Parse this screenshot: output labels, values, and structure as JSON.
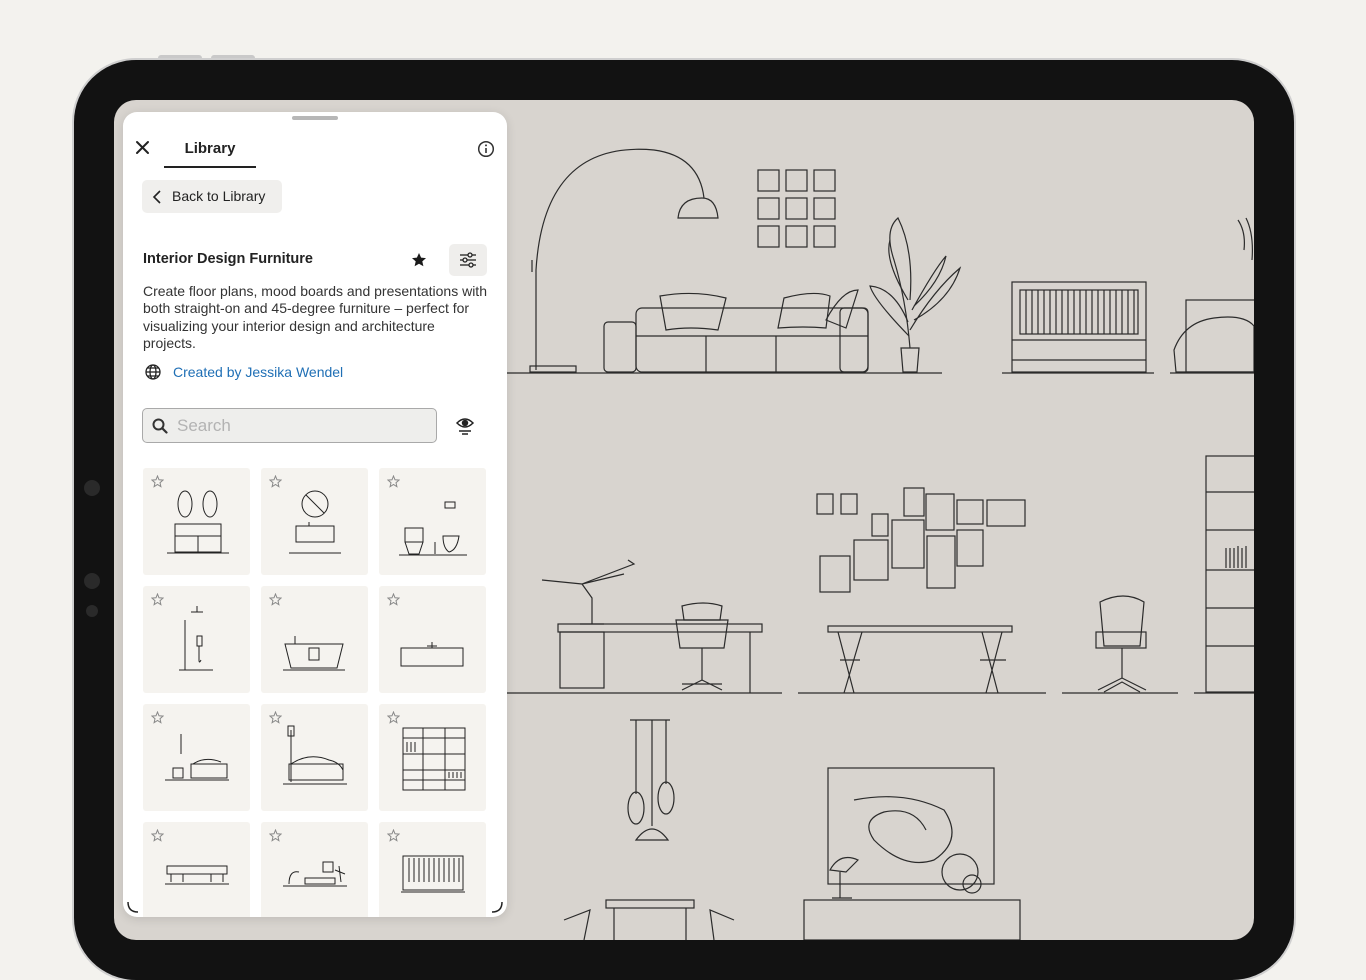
{
  "panel": {
    "tab_label": "Library",
    "back_label": "Back to Library",
    "title": "Interior Design Furniture",
    "description": "Create floor plans, mood boards and presentations with both straight-on and 45-degree furniture – perfect for visualizing your interior design and architecture projects.",
    "author": "Created by Jessika Wendel",
    "search": {
      "placeholder": "Search",
      "value": ""
    },
    "icons": [
      "close-icon",
      "info-icon",
      "chevron-left-icon",
      "star-icon",
      "sliders-icon",
      "globe-icon",
      "search-icon",
      "eye-icon"
    ],
    "items": [
      {
        "name": "double-vanity",
        "favorite": false
      },
      {
        "name": "sink-with-round-mirror",
        "favorite": false
      },
      {
        "name": "toilet-and-bidet",
        "favorite": false
      },
      {
        "name": "rain-shower",
        "favorite": false
      },
      {
        "name": "bathtub",
        "favorite": false
      },
      {
        "name": "countertop-basin",
        "favorite": false
      },
      {
        "name": "bed-with-side-table",
        "favorite": false
      },
      {
        "name": "bed-with-floor-lamp",
        "favorite": false
      },
      {
        "name": "wardrobe-shelving",
        "favorite": false
      },
      {
        "name": "bench",
        "favorite": false
      },
      {
        "name": "desk-setup",
        "favorite": false
      },
      {
        "name": "crib",
        "favorite": false
      }
    ]
  },
  "colors": {
    "accent_link": "#1f6fb5",
    "canvas": "#d8d4cf",
    "tile": "#f5f3ef",
    "bezel": "#121212"
  }
}
